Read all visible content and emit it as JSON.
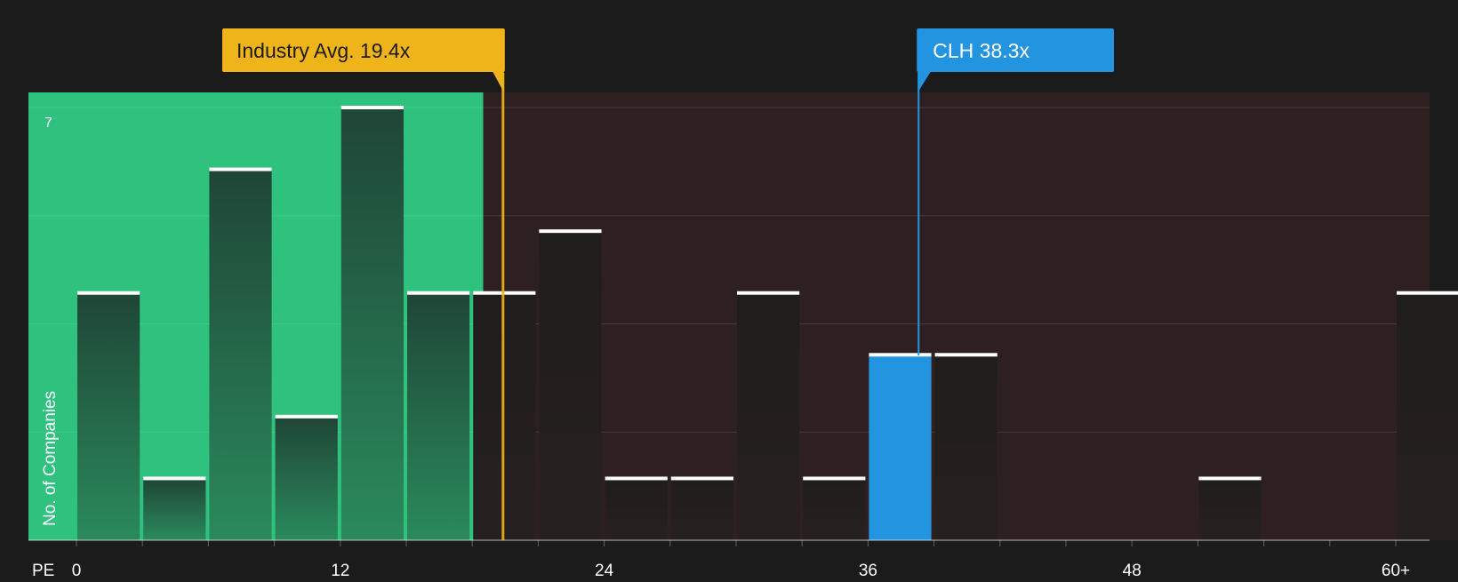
{
  "chart_data": {
    "type": "bar",
    "xlabel": "PE",
    "ylabel": "No. of Companies",
    "x_ticks": [
      "0",
      "12",
      "24",
      "36",
      "48",
      "60+"
    ],
    "y_ticks": [
      "7"
    ],
    "bin_width": 3,
    "bins": [
      {
        "start": 0,
        "value": 4
      },
      {
        "start": 3,
        "value": 1
      },
      {
        "start": 6,
        "value": 6
      },
      {
        "start": 9,
        "value": 2
      },
      {
        "start": 12,
        "value": 7
      },
      {
        "start": 15,
        "value": 4
      },
      {
        "start": 18,
        "value": 4
      },
      {
        "start": 21,
        "value": 5
      },
      {
        "start": 24,
        "value": 1
      },
      {
        "start": 27,
        "value": 1
      },
      {
        "start": 30,
        "value": 4
      },
      {
        "start": 33,
        "value": 1
      },
      {
        "start": 36,
        "value": 3,
        "highlight": true
      },
      {
        "start": 39,
        "value": 3
      },
      {
        "start": 51,
        "value": 1
      },
      {
        "start": 60,
        "value": 4
      }
    ],
    "ylim": [
      0,
      7
    ],
    "xlim": [
      0,
      60
    ],
    "grid": true,
    "industry_avg": {
      "label": "Industry Avg. 19.4x",
      "value": 19.4
    },
    "company": {
      "label": "CLH 38.3x",
      "value": 38.3
    },
    "fair_range_end": 18.5
  },
  "colors": {
    "background": "#1b1b1b",
    "fair_zone": "#2ec27e",
    "overvalued_zone": "#2e1f20",
    "industry_avg": "#f0b41b",
    "company": "#2394e0",
    "bar_in_fair": "#1f5a3c",
    "bar_out": "#2a2222",
    "bar_cap": "#ffffff"
  }
}
